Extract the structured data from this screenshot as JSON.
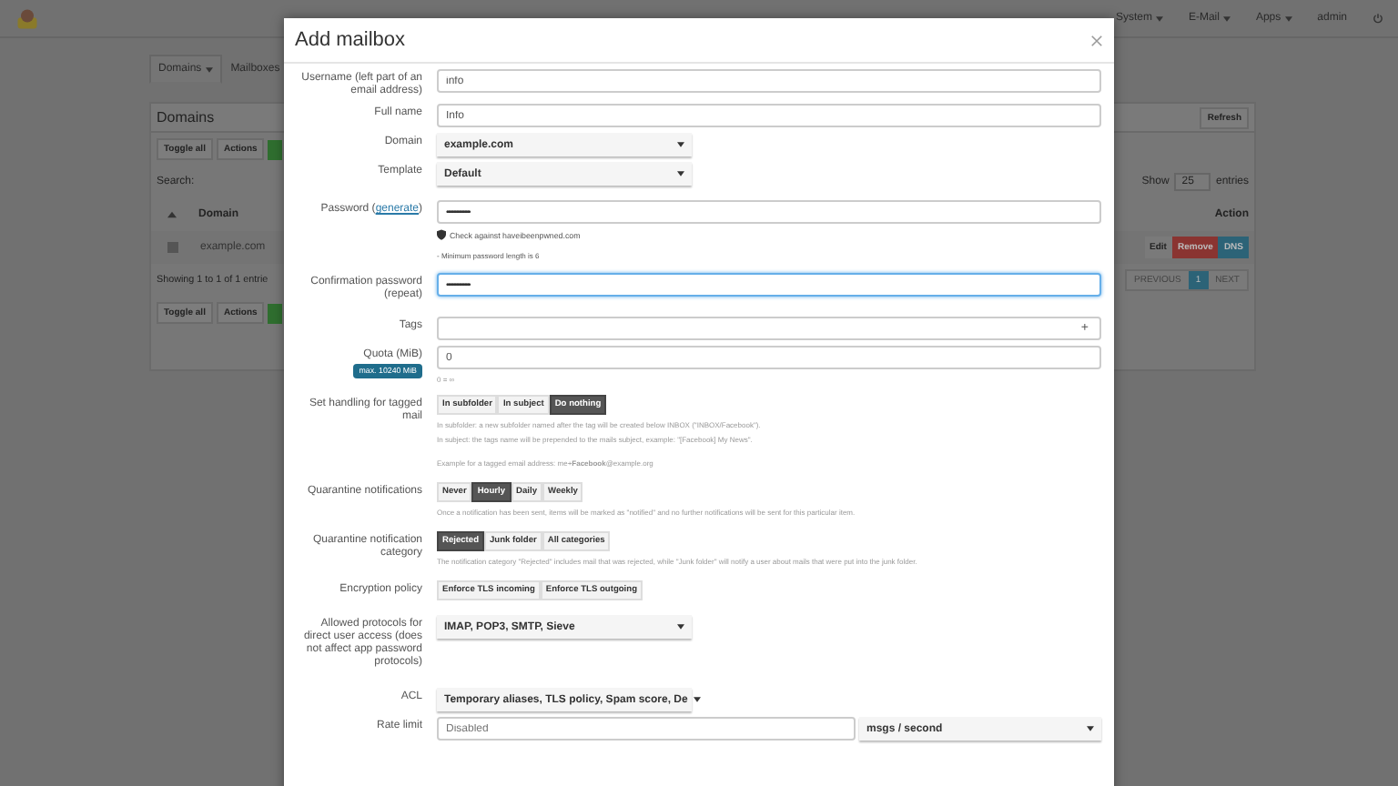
{
  "topnav": {
    "items": [
      {
        "label": "System"
      },
      {
        "label": "E-Mail"
      },
      {
        "label": "Apps"
      }
    ],
    "user": "admin"
  },
  "tabs": [
    {
      "label": "Domains",
      "selected": true
    },
    {
      "label": "Mailboxes",
      "selected": false
    }
  ],
  "panel": {
    "title": "Domains",
    "refresh": "Refresh",
    "toolbar": [
      "Toggle all",
      "Actions"
    ],
    "search_label": "Search:",
    "show": "Show",
    "page_size": "25",
    "entries": "entries",
    "columns": [
      "Domain",
      "Action"
    ],
    "row": {
      "checked": false,
      "domain": "example.com",
      "actions": [
        "Edit",
        "Remove",
        "DNS"
      ]
    },
    "info": "Showing 1 to 1 of 1 entrie",
    "pagination": [
      {
        "label": "PREVIOUS",
        "selected": false
      },
      {
        "label": "1",
        "selected": true
      },
      {
        "label": "NEXT",
        "selected": false
      }
    ],
    "toolbar_bottom": [
      "Toggle all",
      "Actions"
    ]
  },
  "modal": {
    "title": "Add mailbox",
    "fields": [
      {
        "kind": "text",
        "label": "Username (left part of an email address)",
        "value": "info"
      },
      {
        "kind": "text",
        "label": "Full name",
        "value": "Info"
      },
      {
        "kind": "select",
        "label": "Domain",
        "value": "example.com"
      },
      {
        "kind": "select",
        "label": "Template",
        "value": "Default"
      },
      {
        "kind": "password",
        "label": "Password (",
        "link": "generate",
        "label_end": ")",
        "value": "•••••••••••••••••",
        "focused": false,
        "check": "Check against haveibeenpwned.com",
        "help": [
          "- Minimum password length is 6"
        ]
      },
      {
        "kind": "password",
        "label": "Confirmation password (repeat)",
        "value": "•••••••••••••••••",
        "focused": true
      },
      {
        "kind": "tags",
        "label": "Tags",
        "add": "+"
      },
      {
        "kind": "text",
        "label": "Quota (MiB)",
        "badge": "max. 10240 MiB",
        "value": "0",
        "help": [
          "0 = ∞"
        ]
      },
      {
        "kind": "buttons",
        "label": "Set handling for tagged mail",
        "options": [
          {
            "label": "In subfolder",
            "selected": false
          },
          {
            "label": "In subject",
            "selected": false
          },
          {
            "label": "Do nothing",
            "selected": true
          }
        ],
        "help": [
          "In subfolder: a new subfolder named after the tag will be created below INBOX (\"INBOX/Facebook\").",
          "In subject: the tags name will be prepended to the mails subject, example: \"[Facebook] My News\"."
        ],
        "example": "Example for a tagged email address: me+**Facebook**@example.org"
      },
      {
        "kind": "buttons",
        "label": "Quarantine notifications",
        "options": [
          {
            "label": "Never",
            "selected": false
          },
          {
            "label": "Hourly",
            "selected": true
          },
          {
            "label": "Daily",
            "selected": false
          },
          {
            "label": "Weekly",
            "selected": false
          }
        ],
        "help": [
          "Once a notification has been sent, items will be marked as \"notified\" and no further notifications will be sent for this particular item."
        ]
      },
      {
        "kind": "buttons",
        "label": "Quarantine notification category",
        "options": [
          {
            "label": "Rejected",
            "selected": true
          },
          {
            "label": "Junk folder",
            "selected": false
          },
          {
            "label": "All categories",
            "selected": false
          }
        ],
        "help": [
          "The notification category \"Rejected\" includes mail that was rejected, while \"Junk folder\" will notify a user about mails that were put into the junk folder."
        ]
      },
      {
        "kind": "buttons",
        "label": "Encryption policy",
        "options": [
          {
            "label": "Enforce TLS incoming",
            "selected": false
          },
          {
            "label": "Enforce TLS outgoing",
            "selected": false
          }
        ]
      },
      {
        "kind": "select",
        "label": "Allowed protocols for direct user access (does not affect app password protocols)",
        "value": "IMAP, POP3, SMTP, Sieve"
      },
      {
        "kind": "select",
        "label": "ACL",
        "value": "Temporary aliases, TLS policy, Spam score, De"
      },
      {
        "kind": "rate",
        "label": "Rate limit",
        "placeholder": "Disabled",
        "unit": "msgs / second"
      }
    ]
  }
}
